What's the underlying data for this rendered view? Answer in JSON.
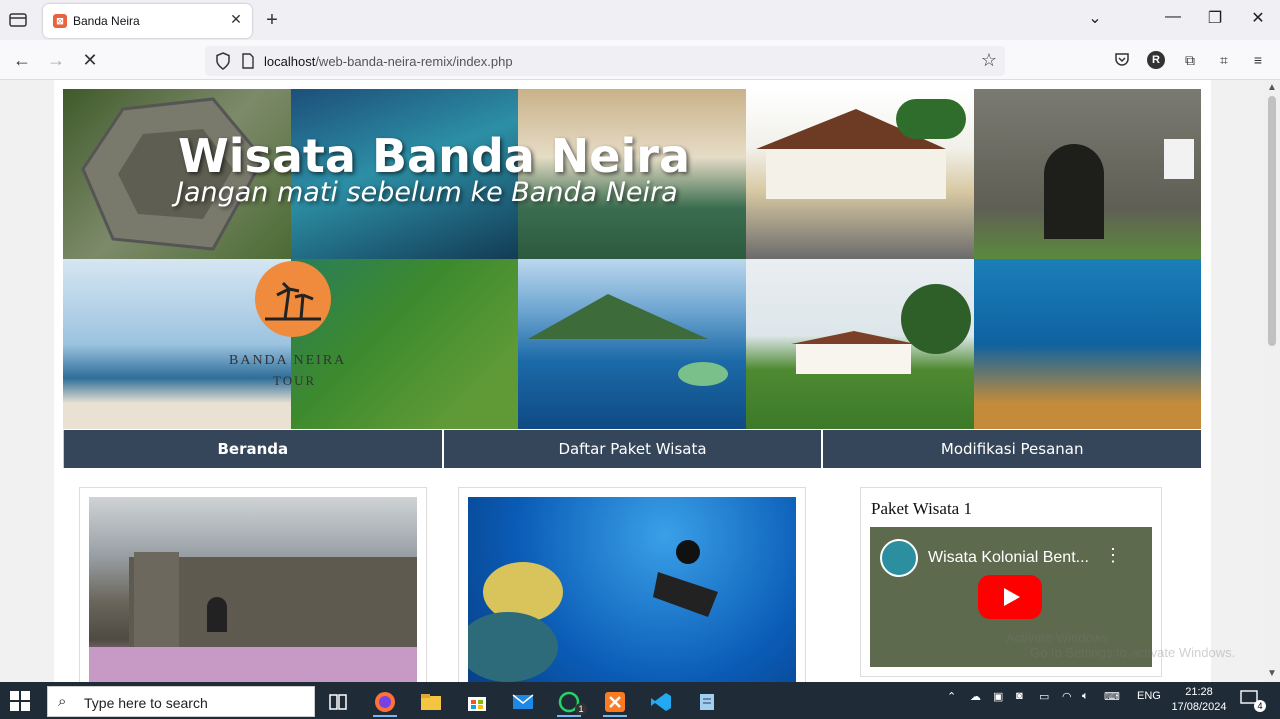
{
  "browser": {
    "tab_title": "Banda Neira",
    "url_host": "localhost",
    "url_path": "/web-banda-neira-remix/index.php",
    "profile_initial": "R"
  },
  "hero": {
    "title": "Wisata Banda Neira",
    "subtitle": "Jangan mati sebelum ke Banda Neira",
    "logo_text": "BANDA NEIRA",
    "logo_sub": "TOUR"
  },
  "menu": [
    "Beranda",
    "Daftar Paket Wisata",
    "Modifikasi Pesanan"
  ],
  "video_card": {
    "title": "Paket Wisata 1",
    "video_title": "Wisata Kolonial Bent..."
  },
  "watermark": {
    "line1": "Activate Windows",
    "line2": "Go to Settings to activate Windows."
  },
  "taskbar": {
    "search_placeholder": "Type here to search",
    "lang": "ENG",
    "time": "21:28",
    "date": "17/08/2024",
    "whatsapp_badge": "1",
    "notif_count": "4"
  },
  "colors": {
    "menu_bg": "#35455a",
    "taskbar_bg": "#1f2b37",
    "youtube_red": "#ff0000"
  }
}
